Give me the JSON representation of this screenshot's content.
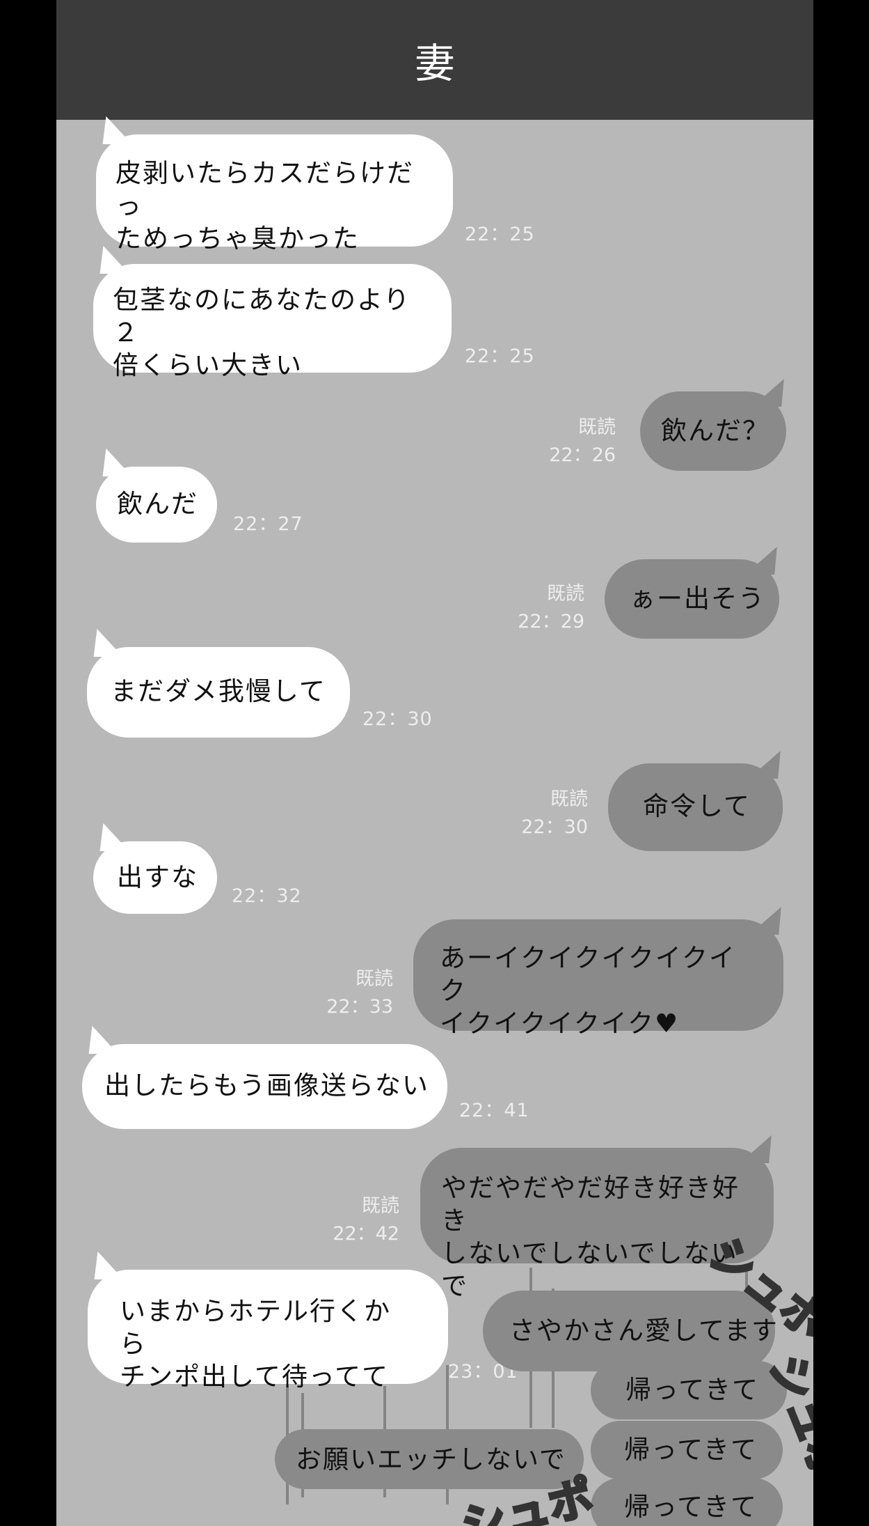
{
  "header": {
    "title": "妻"
  },
  "messages": [
    {
      "dir": "in",
      "text": "皮剥いたらカスだらけだっ\nためっちゃ臭かった",
      "time": "22：25"
    },
    {
      "dir": "in",
      "text": "包茎なのにあなたのより２\n倍くらい大きい",
      "time": "22：25"
    },
    {
      "dir": "out",
      "text": "飲んだ？",
      "read": "既読",
      "time": "22：26"
    },
    {
      "dir": "in",
      "text": "飲んだ",
      "time": "22：27"
    },
    {
      "dir": "out",
      "text": "ぁー出そう",
      "read": "既読",
      "time": "22：29"
    },
    {
      "dir": "in",
      "text": "まだダメ我慢して",
      "time": "22：30"
    },
    {
      "dir": "out",
      "text": "命令して",
      "read": "既読",
      "time": "22：30"
    },
    {
      "dir": "in",
      "text": "出すな",
      "time": "22：32"
    },
    {
      "dir": "out",
      "text": "あーイクイクイクイクイク\nイクイクイクイク♥",
      "read": "既読",
      "time": "22：33"
    },
    {
      "dir": "in",
      "text": "出したらもう画像送らない",
      "time": "22：41"
    },
    {
      "dir": "out",
      "text": "やだやだやだ好き好き好き\nしないでしないでしないで",
      "read": "既読",
      "time": "22：42"
    },
    {
      "dir": "in",
      "text": "いまからホテル行くから\nチンポ出して待ってて",
      "time": "23：01"
    },
    {
      "dir": "out",
      "text": "さやかさん愛してます"
    },
    {
      "dir": "out",
      "text": "帰ってきて"
    },
    {
      "dir": "out",
      "text": "お願いエッチしないで"
    },
    {
      "dir": "out",
      "text": "帰ってきて"
    },
    {
      "dir": "out",
      "text": "帰ってきて"
    }
  ],
  "sfx": [
    "シュポ",
    "シュポ",
    "シュポ"
  ]
}
